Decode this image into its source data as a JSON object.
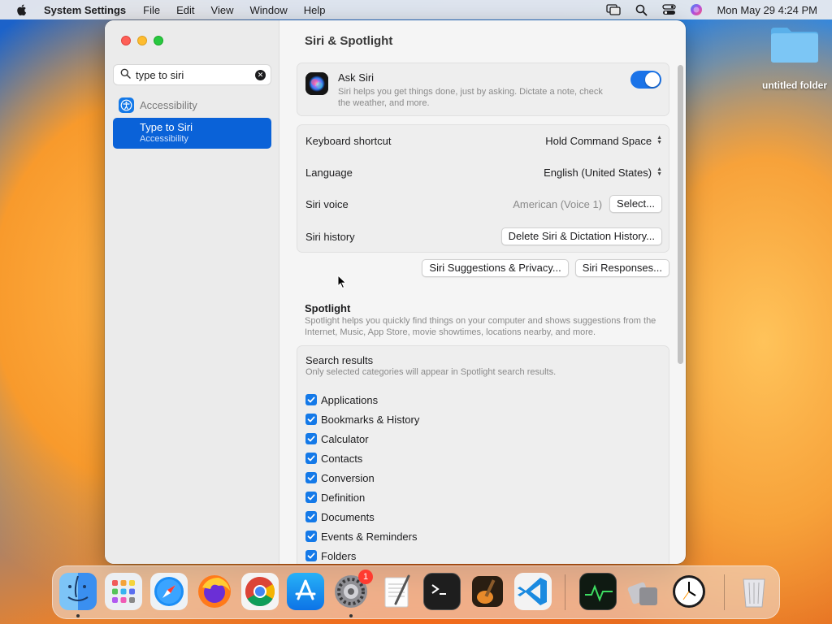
{
  "menubar": {
    "app_name": "System Settings",
    "menus": [
      "File",
      "Edit",
      "View",
      "Window",
      "Help"
    ],
    "clock": "Mon May 29  4:24 PM",
    "icons": [
      "apple-icon",
      "screen-mirroring-icon",
      "spotlight-search-icon",
      "control-center-icon",
      "siri-icon"
    ]
  },
  "desktop": {
    "folder_label": "untitled folder"
  },
  "sidebar": {
    "search": {
      "value": "type to siri",
      "placeholder": "Search"
    },
    "group_label": "Accessibility",
    "selected_item": {
      "title": "Type to Siri",
      "subtitle": "Accessibility"
    }
  },
  "main": {
    "title": "Siri & Spotlight",
    "ask_siri": {
      "title": "Ask Siri",
      "description": "Siri helps you get things done, just by asking. Dictate a note, check the weather, and more.",
      "enabled": true
    },
    "rows": {
      "keyboard_shortcut": {
        "label": "Keyboard shortcut",
        "value": "Hold Command Space"
      },
      "language": {
        "label": "Language",
        "value": "English (United States)"
      },
      "siri_voice": {
        "label": "Siri voice",
        "value": "American (Voice 1)",
        "button": "Select..."
      },
      "siri_history": {
        "label": "Siri history",
        "button": "Delete Siri & Dictation History..."
      }
    },
    "buttons": {
      "suggestions_privacy": "Siri Suggestions & Privacy...",
      "responses": "Siri Responses..."
    },
    "spotlight": {
      "title": "Spotlight",
      "description": "Spotlight helps you quickly find things on your computer and shows suggestions from the Internet, Music, App Store, movie showtimes, locations nearby, and more."
    },
    "search_results": {
      "title": "Search results",
      "description": "Only selected categories will appear in Spotlight search results.",
      "items": [
        {
          "label": "Applications",
          "checked": true
        },
        {
          "label": "Bookmarks & History",
          "checked": true
        },
        {
          "label": "Calculator",
          "checked": true
        },
        {
          "label": "Contacts",
          "checked": true
        },
        {
          "label": "Conversion",
          "checked": true
        },
        {
          "label": "Definition",
          "checked": true
        },
        {
          "label": "Documents",
          "checked": true
        },
        {
          "label": "Events & Reminders",
          "checked": true
        },
        {
          "label": "Folders",
          "checked": true
        }
      ]
    }
  },
  "dock": {
    "apps": [
      "Finder",
      "Launchpad",
      "Safari",
      "Firefox",
      "Chrome",
      "App Store",
      "System Settings",
      "TextEdit",
      "Terminal",
      "GarageBand",
      "Visual Studio Code",
      "Activity Monitor",
      "Migration Assistant",
      "Clock",
      "Trash"
    ],
    "system_settings_badge": "1"
  },
  "colors": {
    "accent": "#0a62d8",
    "toggle_on": "#1a73e8",
    "checkbox": "#1479e8"
  }
}
